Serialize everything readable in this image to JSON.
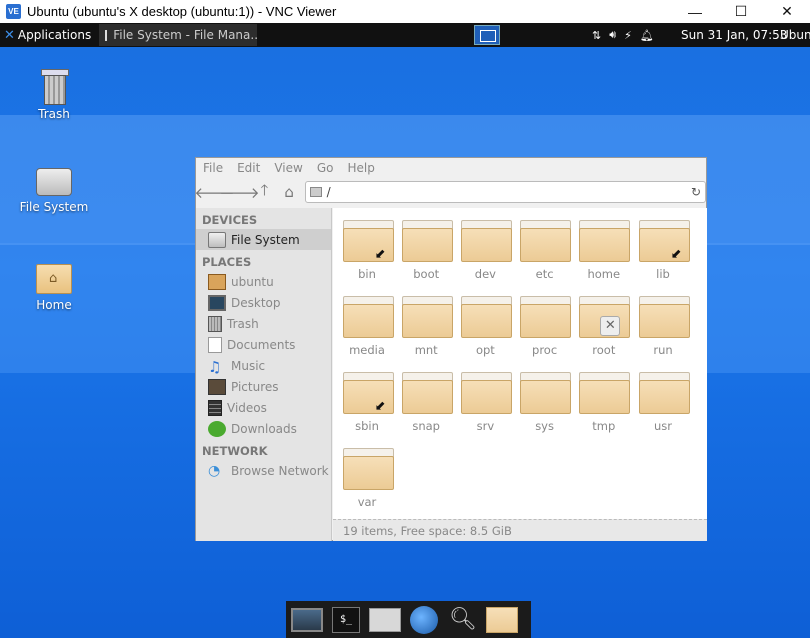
{
  "vnc": {
    "logo": "VE",
    "title": "Ubuntu (ubuntu's X desktop (ubuntu:1)) - VNC Viewer",
    "minimize": "—",
    "maximize": "☐",
    "close": "✕"
  },
  "panel": {
    "applications": "Applications",
    "task_title": "File System - File Mana...",
    "clock": "Sun 31 Jan, 07:53",
    "user": "Ubuntu"
  },
  "desktop_icons": [
    {
      "label": "Trash",
      "icon": "trash-icon"
    },
    {
      "label": "File System",
      "icon": "drive-icon"
    },
    {
      "label": "Home",
      "icon": "home-folder-icon"
    }
  ],
  "file_manager": {
    "menu": [
      "File",
      "Edit",
      "View",
      "Go",
      "Help"
    ],
    "location": "/",
    "sidebar": {
      "devices_header": "DEVICES",
      "devices": [
        {
          "label": "File System",
          "icon": "drive-icon",
          "selected": true
        }
      ],
      "places_header": "PLACES",
      "places": [
        {
          "label": "ubuntu",
          "icon": "home-icon"
        },
        {
          "label": "Desktop",
          "icon": "desktop-icon"
        },
        {
          "label": "Trash",
          "icon": "trash-icon"
        },
        {
          "label": "Documents",
          "icon": "document-icon"
        },
        {
          "label": "Music",
          "icon": "music-icon"
        },
        {
          "label": "Pictures",
          "icon": "pictures-icon"
        },
        {
          "label": "Videos",
          "icon": "videos-icon"
        },
        {
          "label": "Downloads",
          "icon": "download-icon"
        }
      ],
      "network_header": "NETWORK",
      "network": [
        {
          "label": "Browse Network",
          "icon": "network-icon"
        }
      ]
    },
    "folders": [
      {
        "name": "bin",
        "badge": "link"
      },
      {
        "name": "boot",
        "badge": ""
      },
      {
        "name": "dev",
        "badge": ""
      },
      {
        "name": "etc",
        "badge": ""
      },
      {
        "name": "home",
        "badge": ""
      },
      {
        "name": "lib",
        "badge": "link"
      },
      {
        "name": "media",
        "badge": ""
      },
      {
        "name": "mnt",
        "badge": ""
      },
      {
        "name": "opt",
        "badge": ""
      },
      {
        "name": "proc",
        "badge": ""
      },
      {
        "name": "root",
        "badge": "locked"
      },
      {
        "name": "run",
        "badge": ""
      },
      {
        "name": "sbin",
        "badge": "link"
      },
      {
        "name": "snap",
        "badge": ""
      },
      {
        "name": "srv",
        "badge": ""
      },
      {
        "name": "sys",
        "badge": ""
      },
      {
        "name": "tmp",
        "badge": ""
      },
      {
        "name": "usr",
        "badge": ""
      },
      {
        "name": "var",
        "badge": ""
      }
    ],
    "status": "19 items, Free space: 8.5 GiB"
  },
  "dock": {
    "terminal_glyph": "$_"
  }
}
